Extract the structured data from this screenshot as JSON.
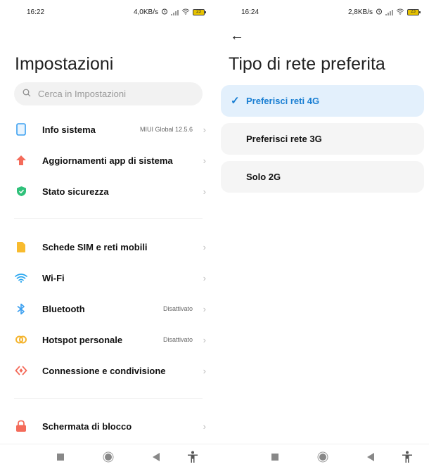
{
  "left": {
    "status": {
      "time": "16:22",
      "speed": "4,0KB/s",
      "battery": "23"
    },
    "title": "Impostazioni",
    "search": {
      "placeholder": "Cerca in Impostazioni"
    },
    "items": [
      {
        "label": "Info sistema",
        "value": "MIUI Global 12.5.6",
        "icon": "phone-icon",
        "color": "#3a9ff0"
      },
      {
        "label": "Aggiornamenti app di sistema",
        "value": "",
        "icon": "arrow-up-icon",
        "color": "#f46b5a"
      },
      {
        "label": "Stato sicurezza",
        "value": "",
        "icon": "shield-icon",
        "color": "#2fc17a"
      },
      {
        "label": "Schede SIM e reti mobili",
        "value": "",
        "icon": "sim-card-icon",
        "color": "#f8bb2e"
      },
      {
        "label": "Wi-Fi",
        "value": "",
        "icon": "wifi-icon",
        "color": "#2aa6ef"
      },
      {
        "label": "Bluetooth",
        "value": "Disattivato",
        "icon": "bluetooth-icon",
        "color": "#3a9ff0"
      },
      {
        "label": "Hotspot personale",
        "value": "Disattivato",
        "icon": "hotspot-icon",
        "color": "#f4b42e"
      },
      {
        "label": "Connessione e condivisione",
        "value": "",
        "icon": "connection-icon",
        "color": "#f46b5a"
      },
      {
        "label": "Schermata di blocco",
        "value": "",
        "icon": "lock-icon",
        "color": "#f46b5a"
      }
    ]
  },
  "right": {
    "status": {
      "time": "16:24",
      "speed": "2,8KB/s",
      "battery": "23"
    },
    "title": "Tipo di rete preferita",
    "options": [
      {
        "label": "Preferisci reti 4G",
        "selected": true
      },
      {
        "label": "Preferisci rete 3G",
        "selected": false
      },
      {
        "label": "Solo 2G",
        "selected": false
      }
    ],
    "accent": "#1a7fd3"
  },
  "chevron": "›",
  "check": "✓",
  "back_arrow": "←"
}
